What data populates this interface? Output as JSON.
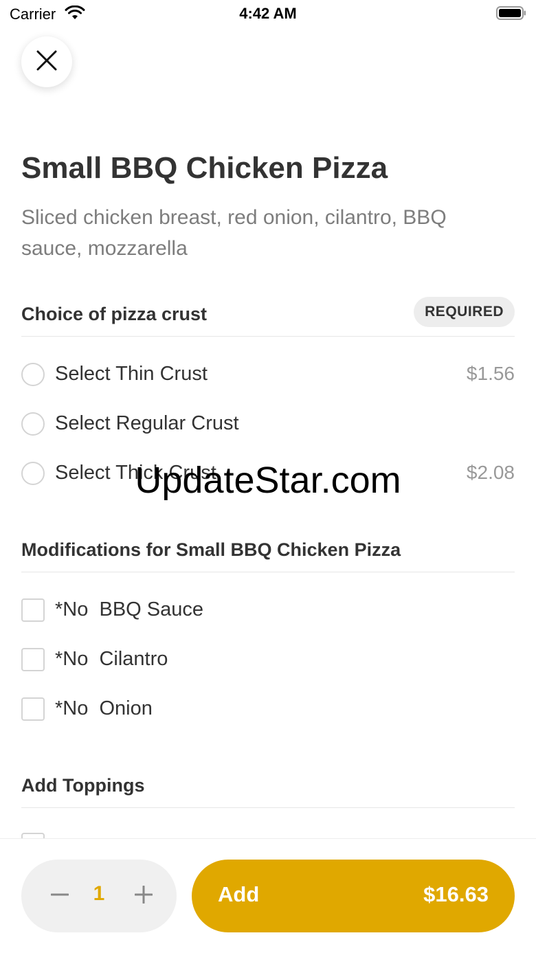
{
  "status_bar": {
    "carrier": "Carrier",
    "time": "4:42 AM",
    "wifi_icon": "wifi-icon",
    "battery_icon": "battery-icon"
  },
  "header": {
    "close_icon": "close-icon"
  },
  "item": {
    "title": "Small BBQ Chicken Pizza",
    "description": "Sliced chicken breast, red onion, cilantro, BBQ sauce, mozzarella"
  },
  "crust_section": {
    "title": "Choice of pizza crust",
    "badge": "REQUIRED",
    "options": [
      {
        "label": "Select Thin Crust",
        "price": "$1.56",
        "selected": false
      },
      {
        "label": "Select Regular Crust",
        "price": "",
        "selected": false
      },
      {
        "label": "Select Thick Crust",
        "price": "$2.08",
        "selected": false
      }
    ]
  },
  "modifications_section": {
    "title": "Modifications for Small BBQ Chicken Pizza",
    "options": [
      {
        "label": "*No  BBQ Sauce",
        "checked": false
      },
      {
        "label": "*No  Cilantro",
        "checked": false
      },
      {
        "label": "*No  Onion",
        "checked": false
      }
    ]
  },
  "toppings_section": {
    "title": "Add Toppings"
  },
  "watermark": "UpdateStar.com",
  "footer": {
    "quantity": "1",
    "minus_icon": "minus-icon",
    "plus_icon": "plus-icon",
    "add_label": "Add",
    "total_price": "$16.63"
  },
  "colors": {
    "accent": "#e0a800",
    "text_primary": "#333333",
    "text_secondary": "#7d7d7d",
    "price_text": "#999999"
  }
}
